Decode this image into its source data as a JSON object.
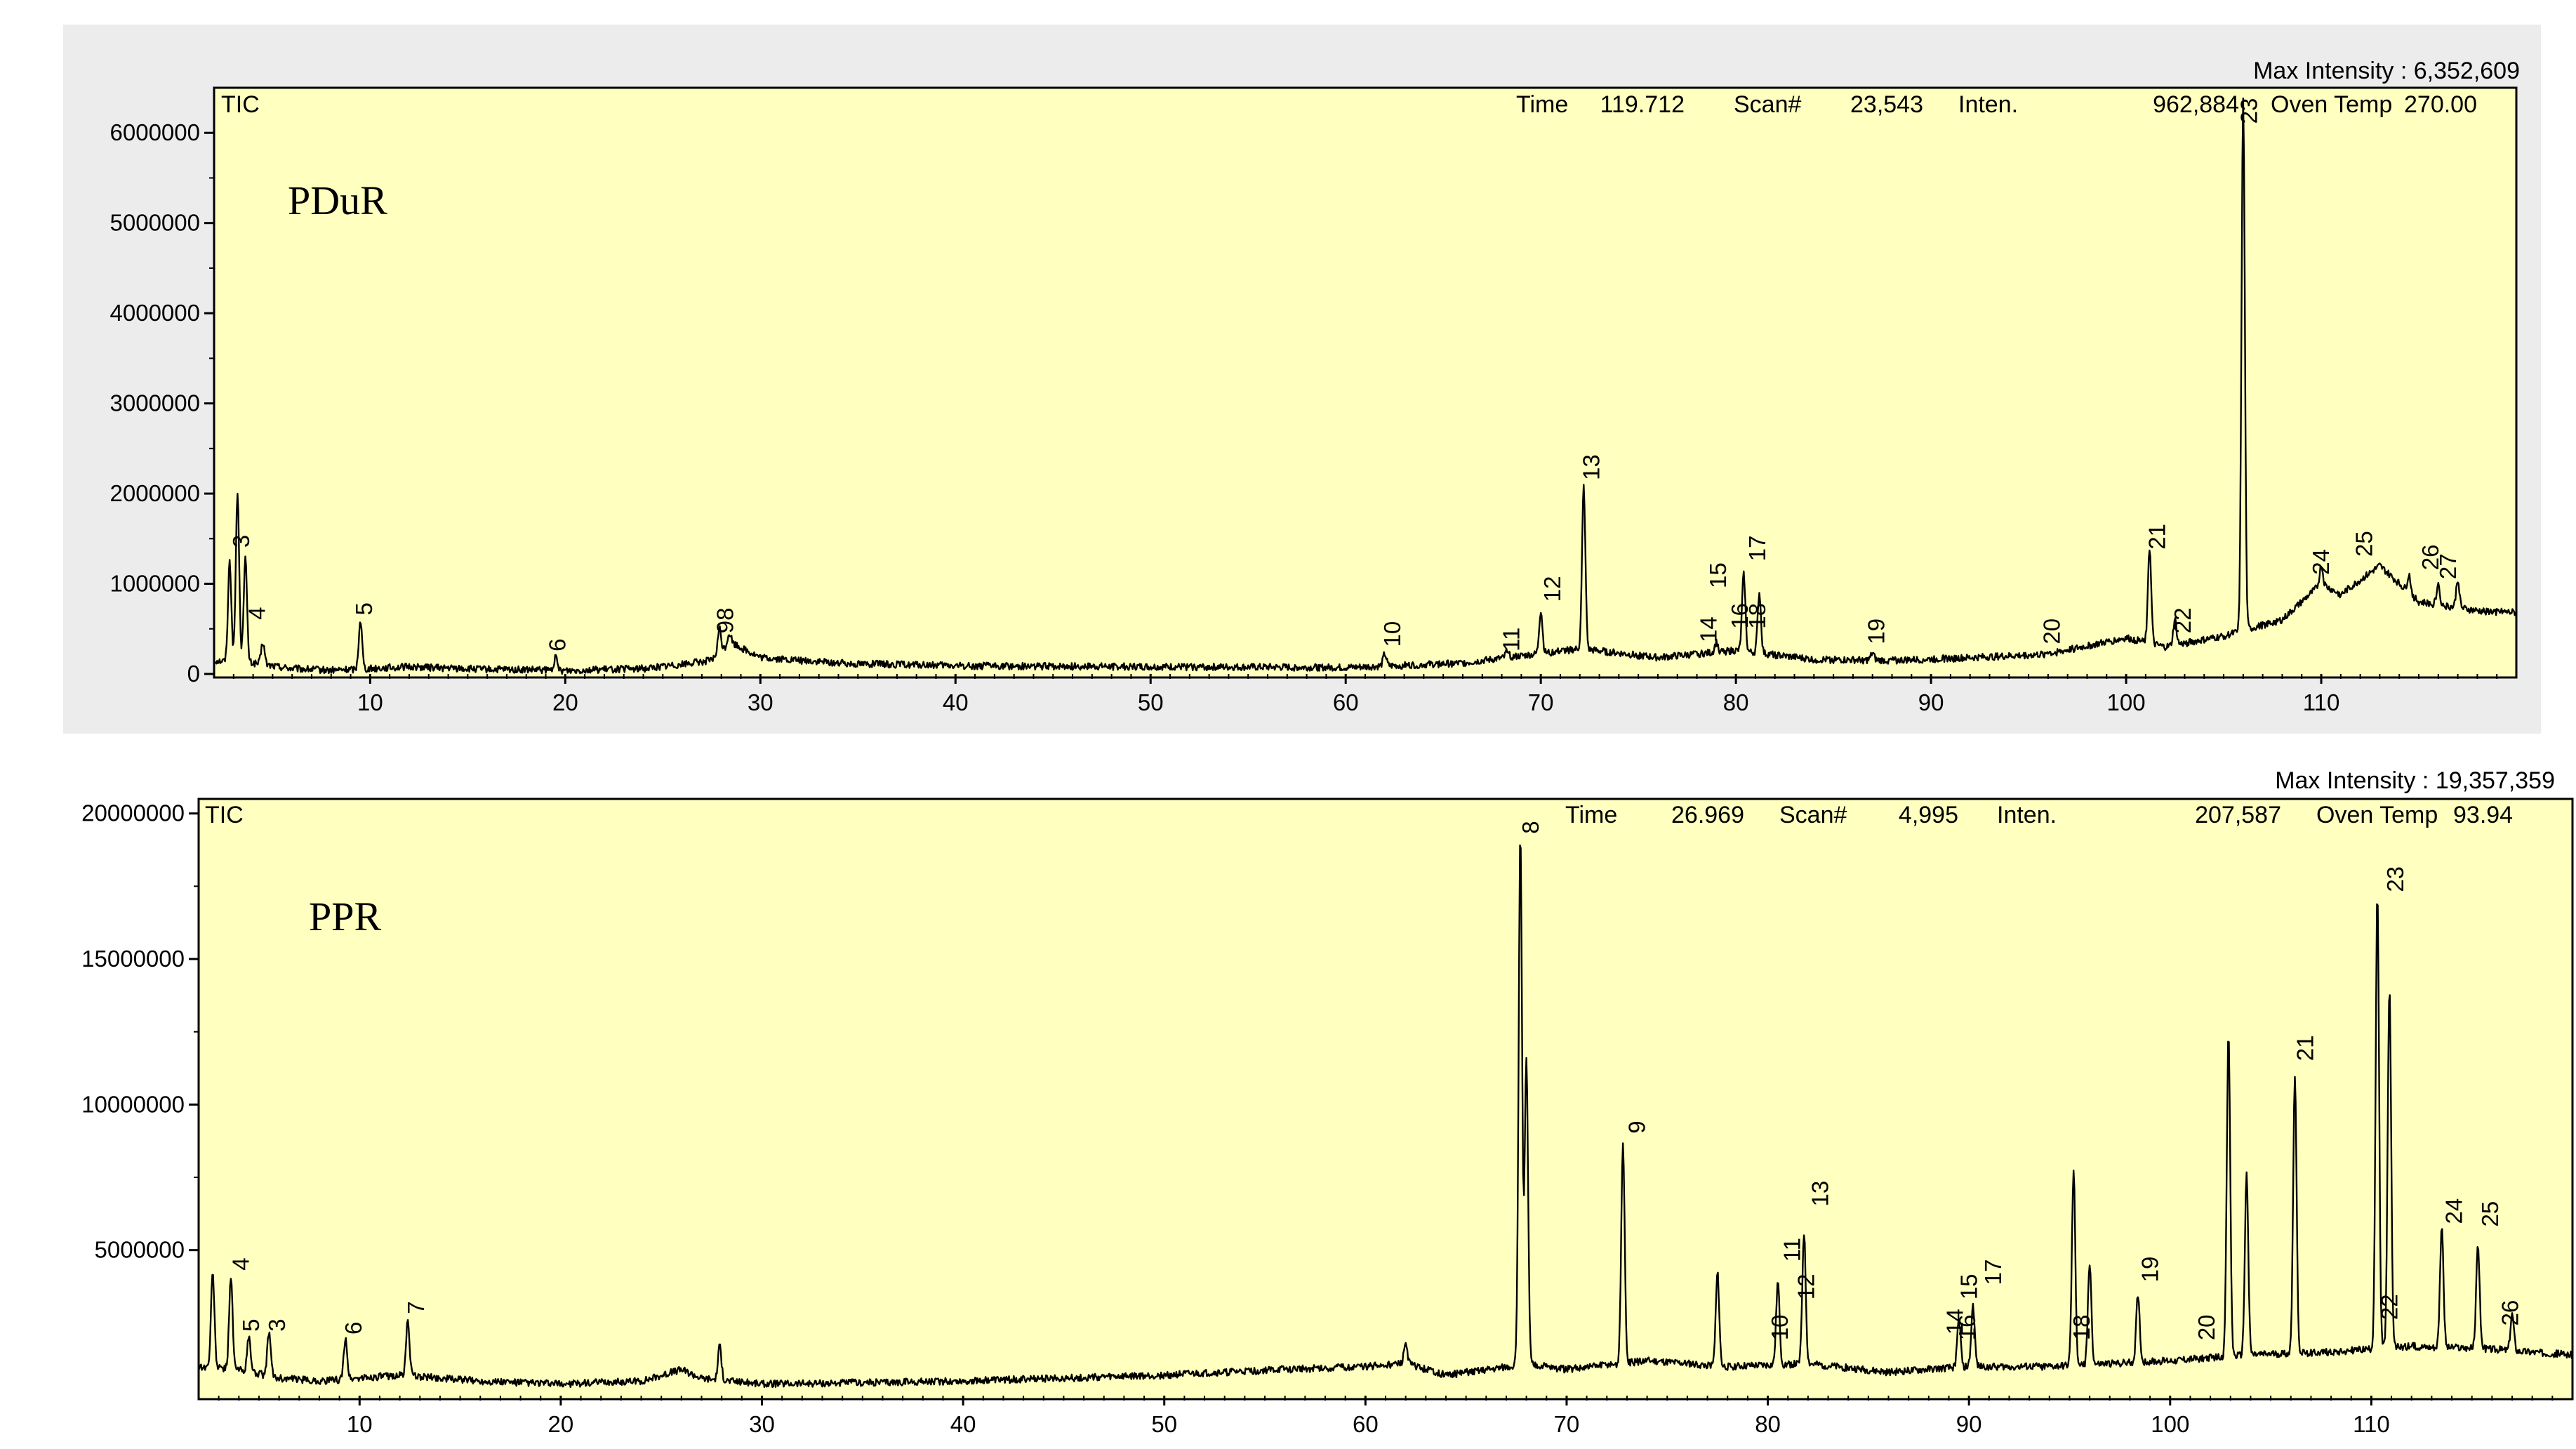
{
  "chart_data": [
    {
      "type": "line",
      "sample_label": "PDuR",
      "signal_label": "TIC",
      "header": {
        "max_intensity": "Max Intensity : 6,352,609",
        "time_label": "Time",
        "time_value": "119.712",
        "scan_label": "Scan#",
        "scan_value": "23,543",
        "inten_label": "Inten.",
        "inten_value": "962,884",
        "oven_label": "Oven Temp",
        "oven_value": "270.00"
      },
      "xlim": [
        2,
        120
      ],
      "ylim": [
        0,
        6500000
      ],
      "x_ticks": [
        10,
        20,
        30,
        40,
        50,
        60,
        70,
        80,
        90,
        100,
        110
      ],
      "y_ticks": [
        0,
        1000000,
        2000000,
        3000000,
        4000000,
        5000000,
        6000000
      ],
      "y_tick_labels": [
        "0",
        "1000000",
        "2000000",
        "3000000",
        "4000000",
        "5000000",
        "6000000"
      ],
      "baseline": [
        [
          2,
          150000
        ],
        [
          4,
          120000
        ],
        [
          6,
          60000
        ],
        [
          8,
          40000
        ],
        [
          12,
          80000
        ],
        [
          16,
          50000
        ],
        [
          20,
          40000
        ],
        [
          24,
          60000
        ],
        [
          26,
          110000
        ],
        [
          27.5,
          150000
        ],
        [
          28.5,
          350000
        ],
        [
          30,
          180000
        ],
        [
          34,
          120000
        ],
        [
          40,
          90000
        ],
        [
          50,
          80000
        ],
        [
          60,
          70000
        ],
        [
          66,
          120000
        ],
        [
          72,
          280000
        ],
        [
          76,
          180000
        ],
        [
          80,
          260000
        ],
        [
          84,
          160000
        ],
        [
          88,
          150000
        ],
        [
          92,
          180000
        ],
        [
          96,
          220000
        ],
        [
          100,
          400000
        ],
        [
          102,
          300000
        ],
        [
          105,
          420000
        ],
        [
          108,
          600000
        ],
        [
          110,
          1000000
        ],
        [
          111,
          880000
        ],
        [
          113,
          1200000
        ],
        [
          115,
          800000
        ],
        [
          118,
          700000
        ],
        [
          120,
          680000
        ]
      ],
      "peaks": [
        {
          "x": 2.8,
          "y": 1250000
        },
        {
          "x": 3.2,
          "y": 2000000
        },
        {
          "x": 3.6,
          "y": 1300000
        },
        {
          "x": 4.5,
          "y": 350000
        },
        {
          "x": 9.5,
          "y": 600000
        },
        {
          "x": 19.5,
          "y": 180000
        },
        {
          "x": 27.9,
          "y": 500000
        },
        {
          "x": 28.4,
          "y": 450000
        },
        {
          "x": 62,
          "y": 220000
        },
        {
          "x": 68.3,
          "y": 280000
        },
        {
          "x": 70,
          "y": 700000
        },
        {
          "x": 72.2,
          "y": 2080000
        },
        {
          "x": 79,
          "y": 350000
        },
        {
          "x": 80.4,
          "y": 1100000
        },
        {
          "x": 81.2,
          "y": 900000
        },
        {
          "x": 87,
          "y": 230000
        },
        {
          "x": 96,
          "y": 250000
        },
        {
          "x": 101.2,
          "y": 1400000
        },
        {
          "x": 102.5,
          "y": 600000
        },
        {
          "x": 106,
          "y": 6350000
        },
        {
          "x": 110,
          "y": 1200000
        },
        {
          "x": 113,
          "y": 1200000
        },
        {
          "x": 114.5,
          "y": 1100000
        },
        {
          "x": 116,
          "y": 1000000
        },
        {
          "x": 117,
          "y": 1050000
        }
      ],
      "peak_labels": [
        {
          "text": "3",
          "x": 3.8,
          "y": 1400000
        },
        {
          "text": "4",
          "x": 4.6,
          "y": 600000
        },
        {
          "text": "5",
          "x": 10.1,
          "y": 650000
        },
        {
          "text": "6",
          "x": 20,
          "y": 250000
        },
        {
          "text": "98",
          "x": 28.6,
          "y": 450000
        },
        {
          "text": "10",
          "x": 62.8,
          "y": 300000
        },
        {
          "text": "11",
          "x": 68.9,
          "y": 250000
        },
        {
          "text": "12",
          "x": 71,
          "y": 800000
        },
        {
          "text": "13",
          "x": 73,
          "y": 2150000
        },
        {
          "text": "14",
          "x": 79,
          "y": 350000
        },
        {
          "text": "15",
          "x": 79.5,
          "y": 950000
        },
        {
          "text": "16",
          "x": 80.6,
          "y": 500000
        },
        {
          "text": "17",
          "x": 81.5,
          "y": 1250000
        },
        {
          "text": "18",
          "x": 81.5,
          "y": 500000
        },
        {
          "text": "19",
          "x": 87.6,
          "y": 330000
        },
        {
          "text": "20",
          "x": 96.6,
          "y": 330000
        },
        {
          "text": "21",
          "x": 102,
          "y": 1380000
        },
        {
          "text": "22",
          "x": 103.3,
          "y": 450000
        },
        {
          "text": "23",
          "x": 106.7,
          "y": 6100000
        },
        {
          "text": "24",
          "x": 110.4,
          "y": 1100000
        },
        {
          "text": "25",
          "x": 112.6,
          "y": 1300000
        },
        {
          "text": "26",
          "x": 116,
          "y": 1150000
        },
        {
          "text": "27",
          "x": 116.9,
          "y": 1050000
        }
      ]
    },
    {
      "type": "line",
      "sample_label": "PPR",
      "signal_label": "TIC",
      "header": {
        "max_intensity": "Max Intensity : 19,357,359",
        "time_label": "Time",
        "time_value": "26.969",
        "scan_label": "Scan#",
        "scan_value": "4,995",
        "inten_label": "Inten.",
        "inten_value": "207,587",
        "oven_label": "Oven Temp",
        "oven_value": "93.94"
      },
      "xlim": [
        2,
        120
      ],
      "ylim": [
        0,
        20500000
      ],
      "x_ticks": [
        10,
        20,
        30,
        40,
        50,
        60,
        70,
        80,
        90,
        100,
        110
      ],
      "y_ticks": [
        5000000,
        10000000,
        15000000,
        20000000
      ],
      "y_tick_labels": [
        "5000000",
        "10000000",
        "15000000",
        "20000000"
      ],
      "baseline": [
        [
          2,
          1000000
        ],
        [
          4,
          900000
        ],
        [
          6,
          600000
        ],
        [
          8,
          500000
        ],
        [
          12,
          700000
        ],
        [
          16,
          500000
        ],
        [
          20,
          400000
        ],
        [
          24,
          500000
        ],
        [
          26,
          900000
        ],
        [
          27,
          600000
        ],
        [
          30,
          400000
        ],
        [
          40,
          500000
        ],
        [
          50,
          700000
        ],
        [
          56,
          900000
        ],
        [
          60,
          1000000
        ],
        [
          62,
          1100000
        ],
        [
          64,
          700000
        ],
        [
          66,
          900000
        ],
        [
          68,
          1100000
        ],
        [
          70,
          900000
        ],
        [
          74,
          1200000
        ],
        [
          78,
          1000000
        ],
        [
          82,
          1100000
        ],
        [
          86,
          800000
        ],
        [
          90,
          1000000
        ],
        [
          94,
          1000000
        ],
        [
          100,
          1200000
        ],
        [
          104,
          1400000
        ],
        [
          108,
          1500000
        ],
        [
          112,
          1700000
        ],
        [
          116,
          1600000
        ],
        [
          120,
          1400000
        ]
      ],
      "peaks": [
        {
          "x": 2.7,
          "y": 4200000
        },
        {
          "x": 3.6,
          "y": 4100000
        },
        {
          "x": 4.5,
          "y": 2000000
        },
        {
          "x": 5.5,
          "y": 2200000
        },
        {
          "x": 9.3,
          "y": 2000000
        },
        {
          "x": 12.4,
          "y": 2600000
        },
        {
          "x": 27.9,
          "y": 1700000
        },
        {
          "x": 62,
          "y": 1800000
        },
        {
          "x": 67.7,
          "y": 19350000
        },
        {
          "x": 68,
          "y": 11500000
        },
        {
          "x": 72.8,
          "y": 8700000
        },
        {
          "x": 77.5,
          "y": 4200000
        },
        {
          "x": 80.5,
          "y": 3900000
        },
        {
          "x": 81.8,
          "y": 5600000
        },
        {
          "x": 89.5,
          "y": 2600000
        },
        {
          "x": 90.2,
          "y": 3100000
        },
        {
          "x": 95.2,
          "y": 7700000
        },
        {
          "x": 96,
          "y": 4600000
        },
        {
          "x": 98.4,
          "y": 3500000
        },
        {
          "x": 102.9,
          "y": 12500000
        },
        {
          "x": 103.8,
          "y": 7600000
        },
        {
          "x": 106.2,
          "y": 11000000
        },
        {
          "x": 110.3,
          "y": 17300000
        },
        {
          "x": 110.9,
          "y": 14000000
        },
        {
          "x": 113.5,
          "y": 5800000
        },
        {
          "x": 115.3,
          "y": 5200000
        },
        {
          "x": 117,
          "y": 2800000
        }
      ],
      "peak_labels": [
        {
          "text": "4",
          "x": 4.5,
          "y": 4300000
        },
        {
          "text": "5",
          "x": 5,
          "y": 2200000
        },
        {
          "text": "3",
          "x": 6.3,
          "y": 2200000
        },
        {
          "text": "6",
          "x": 10.1,
          "y": 2100000
        },
        {
          "text": "7",
          "x": 13.2,
          "y": 2800000
        },
        {
          "text": "8",
          "x": 68.6,
          "y": 19300000
        },
        {
          "text": "9",
          "x": 73.9,
          "y": 9000000
        },
        {
          "text": "10",
          "x": 81,
          "y": 1900000
        },
        {
          "text": "11",
          "x": 81.6,
          "y": 4600000
        },
        {
          "text": "12",
          "x": 82.3,
          "y": 3300000
        },
        {
          "text": "13",
          "x": 83,
          "y": 6500000
        },
        {
          "text": "14",
          "x": 89.7,
          "y": 2100000
        },
        {
          "text": "15",
          "x": 90.4,
          "y": 3300000
        },
        {
          "text": "16",
          "x": 90.3,
          "y": 1900000
        },
        {
          "text": "17",
          "x": 91.6,
          "y": 3800000
        },
        {
          "text": "18",
          "x": 96,
          "y": 1900000
        },
        {
          "text": "19",
          "x": 99.4,
          "y": 3900000
        },
        {
          "text": "20",
          "x": 102.2,
          "y": 1900000
        },
        {
          "text": "21",
          "x": 107.1,
          "y": 11500000
        },
        {
          "text": "22",
          "x": 111.3,
          "y": 2600000
        },
        {
          "text": "23",
          "x": 111.6,
          "y": 17300000
        },
        {
          "text": "24",
          "x": 114.5,
          "y": 5900000
        },
        {
          "text": "25",
          "x": 116.3,
          "y": 5800000
        },
        {
          "text": "26",
          "x": 117.3,
          "y": 2400000
        }
      ]
    }
  ]
}
